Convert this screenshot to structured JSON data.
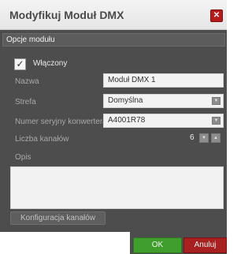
{
  "dialog": {
    "title": "Modyfikuj Moduł DMX",
    "close_glyph": "✕"
  },
  "section": {
    "header": "Opcje modułu"
  },
  "enabled": {
    "checked": true,
    "check_glyph": "✓",
    "label": "Włączony"
  },
  "form": {
    "name": {
      "label": "Nazwa",
      "value": "Moduł DMX 1"
    },
    "zone": {
      "label": "Strefa",
      "value": "Domyślna"
    },
    "serial": {
      "label": "Numer seryjny konwertera",
      "value": "A4001R78"
    },
    "channels": {
      "label": "Liczba kanałów",
      "value": "6"
    },
    "description": {
      "label": "Opis",
      "value": ""
    },
    "dropdown_arrow": "▼",
    "stepper_down": "▼",
    "stepper_up": "▲"
  },
  "buttons": {
    "channel_config": "Konfiguracja kanałów",
    "ok": "OK",
    "cancel": "Anuluj"
  },
  "colors": {
    "ok": "#3f9e2c",
    "cancel": "#a82020",
    "panel": "#4d4d4d"
  }
}
